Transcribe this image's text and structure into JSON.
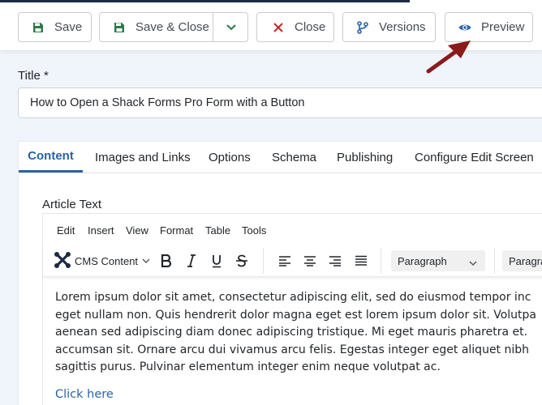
{
  "toolbar": {
    "save_label": "Save",
    "save_close_label": "Save & Close",
    "close_label": "Close",
    "versions_label": "Versions",
    "preview_label": "Preview"
  },
  "title_field": {
    "label": "Title *",
    "value": "How to Open a Shack Forms Pro Form with a Button"
  },
  "tabs": [
    "Content",
    "Images and Links",
    "Options",
    "Schema",
    "Publishing",
    "Configure Edit Screen"
  ],
  "editor": {
    "label": "Article Text",
    "menu": [
      "Edit",
      "Insert",
      "View",
      "Format",
      "Table",
      "Tools"
    ],
    "cms_content_label": "CMS Content",
    "block_format": "Paragraph",
    "block_format_2": "Paragra",
    "lines": [
      "Lorem ipsum dolor sit amet, consectetur adipiscing elit, sed do eiusmod tempor inc",
      "eget nullam non. Quis hendrerit dolor magna eget est lorem ipsum dolor sit. Volutpa",
      "aenean sed adipiscing diam donec adipiscing tristique. Mi eget mauris pharetra et.",
      "accumsan sit. Ornare arcu dui vivamus arcu felis. Egestas integer eget aliquet nibh",
      "sagittis purus. Pulvinar elementum integer enim neque volutpat ac."
    ],
    "link_text": "Click here"
  },
  "colors": {
    "accent": "#2a63a6",
    "close_icon": "#c52827",
    "save_icon": "#2d7a46",
    "arrow": "#8b1a1a"
  }
}
